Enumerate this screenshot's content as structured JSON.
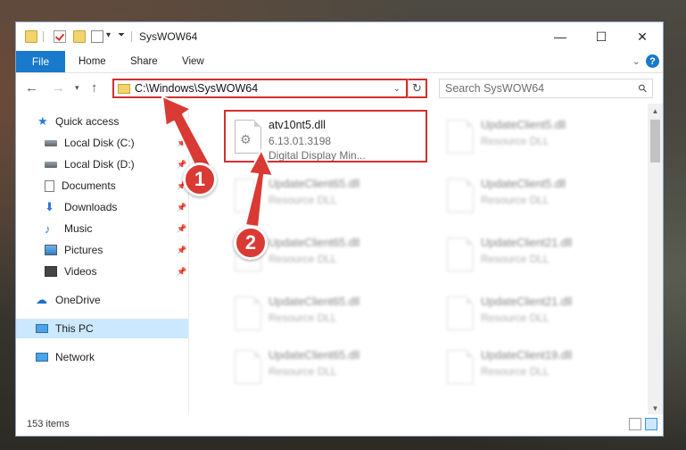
{
  "window": {
    "title": "SysWOW64",
    "controls": {
      "minimize": "—",
      "maximize": "☐",
      "close": "✕"
    }
  },
  "ribbon": {
    "tabs": [
      "File",
      "Home",
      "Share",
      "View"
    ],
    "help": "?"
  },
  "navigation": {
    "back": "←",
    "forward": "→",
    "recent": "▾",
    "up": "↑",
    "address": "C:\\Windows\\SysWOW64",
    "refresh": "↻",
    "search_placeholder": "Search SysWOW64"
  },
  "sidebar": {
    "items": [
      {
        "label": "Quick access",
        "icon": "star-icon",
        "pinned": false
      },
      {
        "label": "Local Disk (C:)",
        "icon": "drive-icon",
        "pinned": true
      },
      {
        "label": "Local Disk (D:)",
        "icon": "drive-icon",
        "pinned": true
      },
      {
        "label": "Documents",
        "icon": "document-icon",
        "pinned": true
      },
      {
        "label": "Downloads",
        "icon": "download-icon",
        "pinned": true
      },
      {
        "label": "Music",
        "icon": "music-icon",
        "pinned": true
      },
      {
        "label": "Pictures",
        "icon": "pictures-icon",
        "pinned": true
      },
      {
        "label": "Videos",
        "icon": "videos-icon",
        "pinned": true
      },
      {
        "label": "OneDrive",
        "icon": "cloud-icon",
        "pinned": false
      },
      {
        "label": "This PC",
        "icon": "computer-icon",
        "pinned": false,
        "selected": true
      },
      {
        "label": "Network",
        "icon": "network-icon",
        "pinned": false
      }
    ]
  },
  "files": {
    "selected": {
      "name": "atv10nt5.dll",
      "version": "6.13.01.3198",
      "description": "Digital Display Min..."
    },
    "left_column": [
      {
        "name": "UpdateClient65.dll",
        "type": "Resource DLL"
      },
      {
        "name": "UpdateClient65.dll",
        "type": "Resource DLL"
      },
      {
        "name": "UpdateClient65.dll",
        "type": "Resource DLL"
      },
      {
        "name": "UpdateClient65.dll",
        "type": "Resource DLL"
      }
    ],
    "right_column": [
      {
        "name": "UpdateClient5.dll",
        "type": "Resource DLL"
      },
      {
        "name": "UpdateClient5.dll",
        "type": "Resource DLL"
      },
      {
        "name": "UpdateClient21.dll",
        "type": "Resource DLL"
      },
      {
        "name": "UpdateClient21.dll",
        "type": "Resource DLL"
      },
      {
        "name": "UpdateClient19.dll",
        "type": "Resource DLL"
      }
    ]
  },
  "status": {
    "items": "153 items"
  },
  "annotations": {
    "badge1": "1",
    "badge2": "2"
  },
  "colors": {
    "accent": "#1979ca",
    "highlight": "#d22f2f",
    "selected": "#cce8ff"
  }
}
